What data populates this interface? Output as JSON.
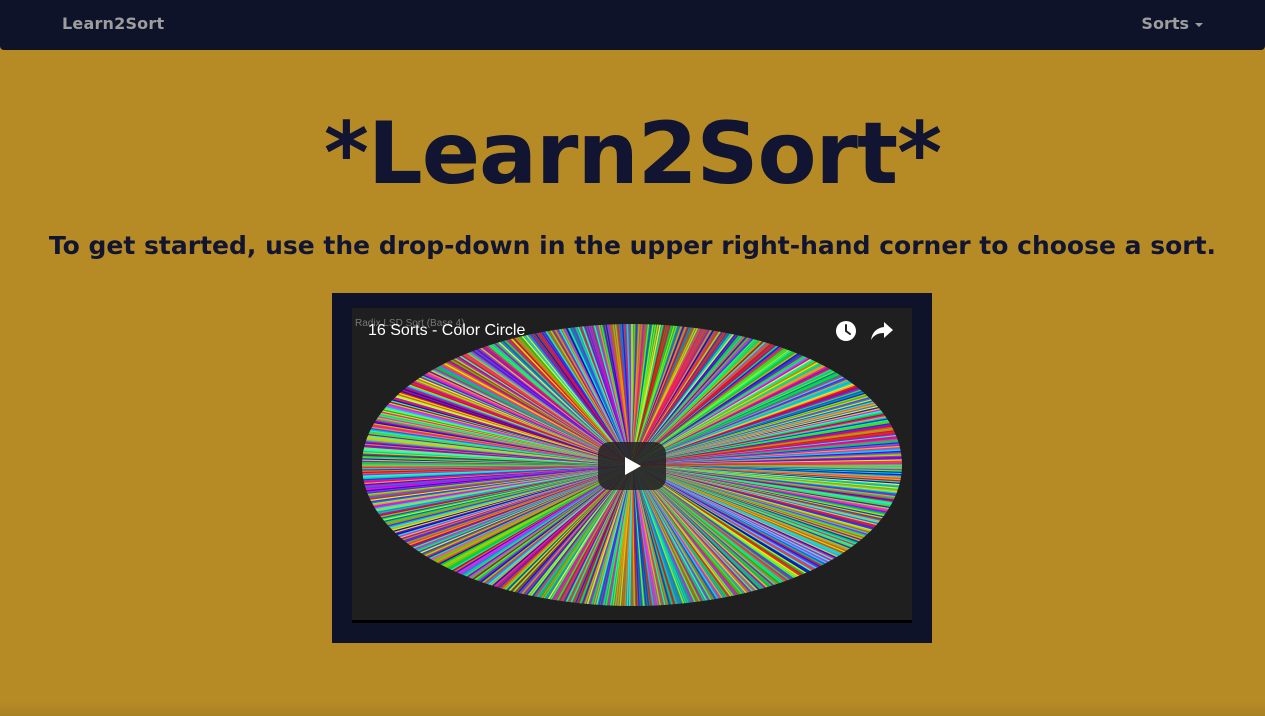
{
  "navbar": {
    "brand": "Learn2Sort",
    "dropdown_label": "Sorts"
  },
  "hero": {
    "title": "*Learn2Sort*",
    "subtitle": "To get started, use the drop-down in the upper right-hand corner to choose a sort."
  },
  "video": {
    "title": "16 Sorts - Color Circle",
    "overlay_caption": "Radix LSD Sort (Base 4)",
    "icons": [
      "watch-later-icon",
      "share-icon",
      "play-icon"
    ]
  },
  "colors": {
    "background": "#b68b26",
    "navbar": "#0f1329",
    "heading": "#111531",
    "nav_text": "#9d9d9d"
  }
}
